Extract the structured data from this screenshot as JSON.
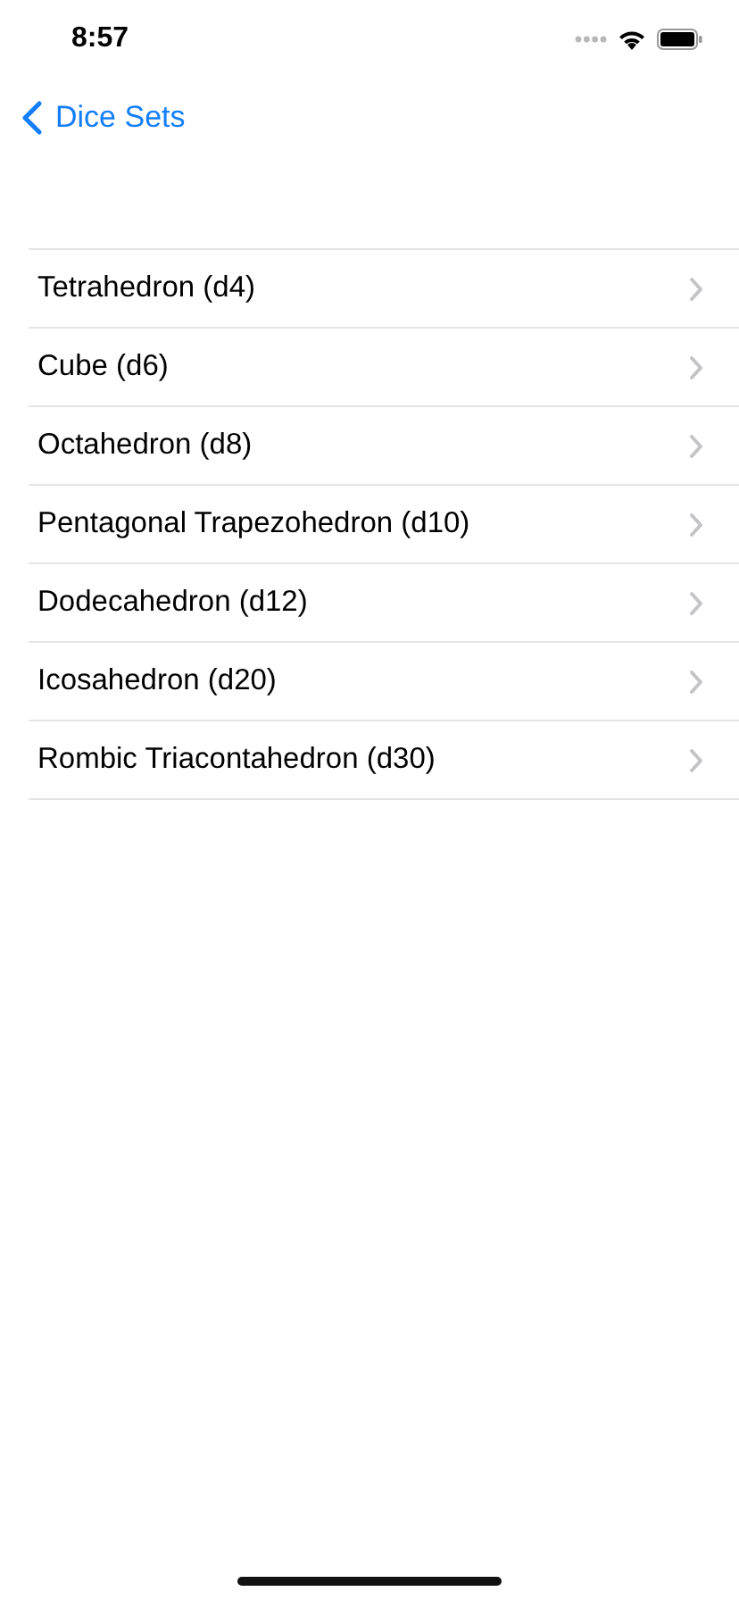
{
  "status_bar": {
    "time": "8:57"
  },
  "nav": {
    "back_label": "Dice Sets"
  },
  "rows": [
    {
      "label": "Tetrahedron (d4)"
    },
    {
      "label": "Cube (d6)"
    },
    {
      "label": "Octahedron (d8)"
    },
    {
      "label": "Pentagonal Trapezohedron (d10)"
    },
    {
      "label": "Dodecahedron (d12)"
    },
    {
      "label": "Icosahedron (d20)"
    },
    {
      "label": "Rombic Triacontahedron (d30)"
    }
  ]
}
